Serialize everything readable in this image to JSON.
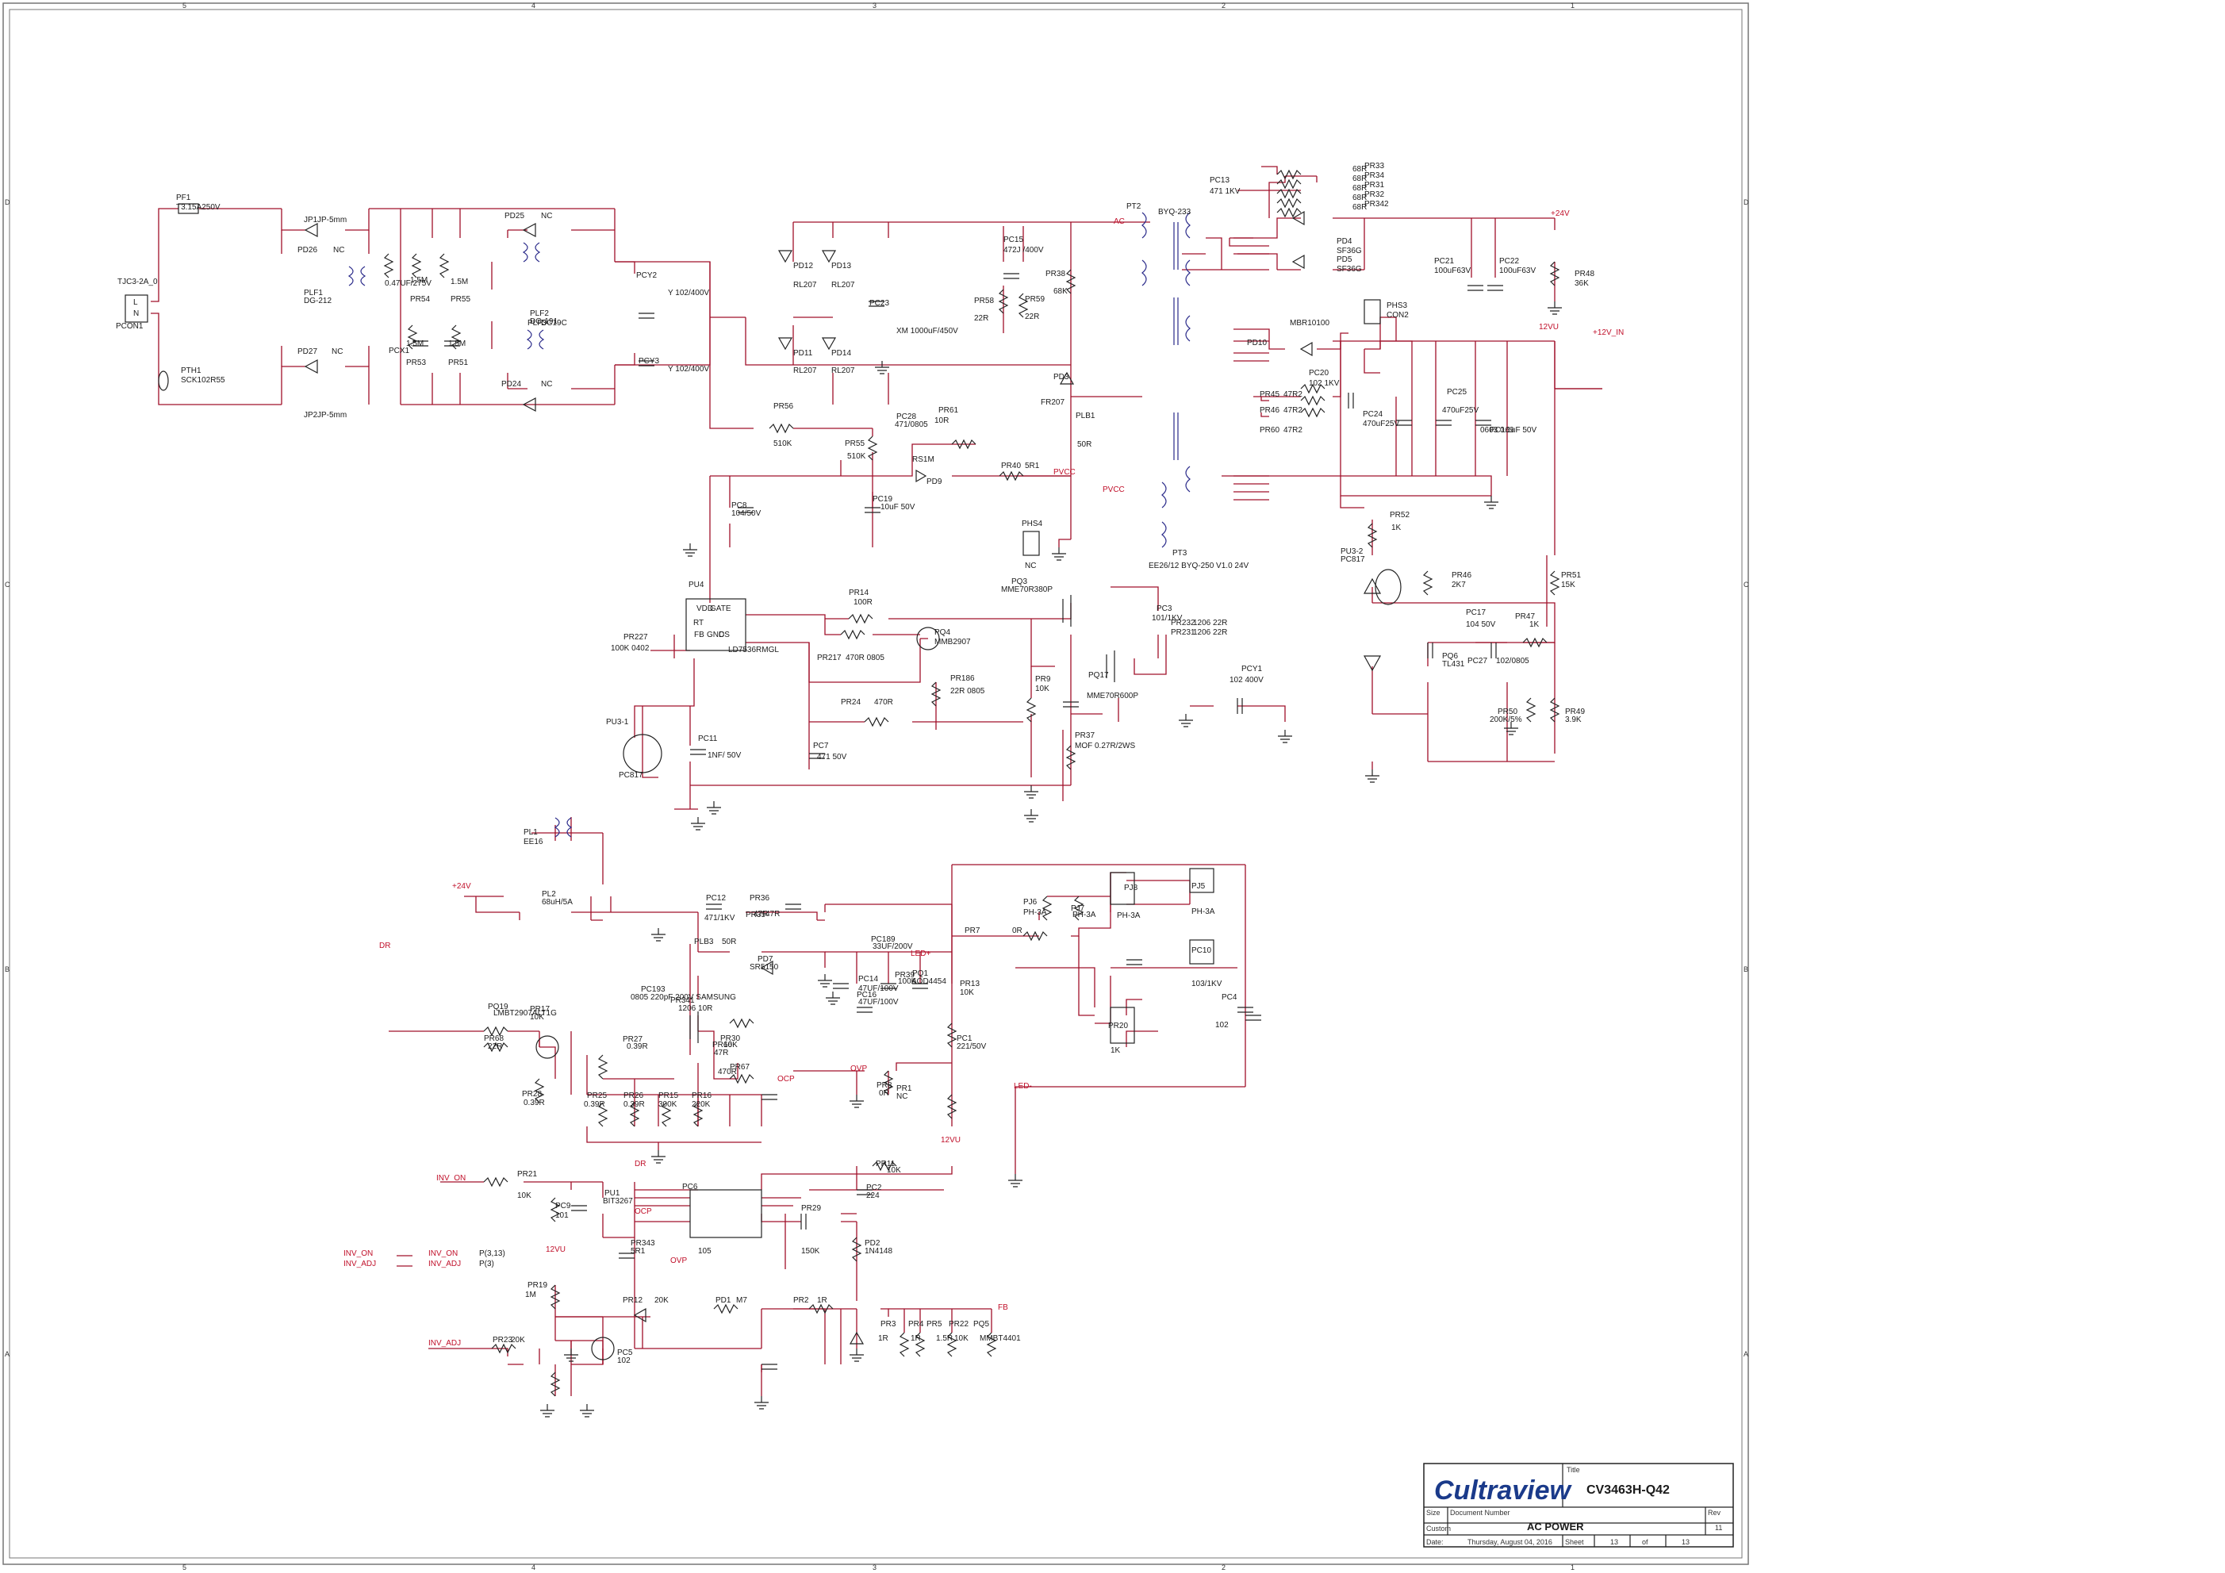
{
  "frame": {
    "top_numbers": [
      "5",
      "4",
      "3",
      "2",
      "1"
    ],
    "side_letters": [
      "D",
      "C",
      "B",
      "A"
    ]
  },
  "title_block": {
    "logo": "Cultraview",
    "title_label": "Title",
    "title": "CV3463H-Q42",
    "size_label": "Size",
    "size_value": "Custom",
    "doc_label": "Document Number",
    "doc_value": "AC POWER",
    "rev_label": "Rev",
    "rev_value": "11",
    "date_label": "Date:",
    "date_value": "Thursday, August 04, 2016",
    "sheet_label": "Sheet",
    "sheet_value": "13",
    "of_label": "of",
    "of_value": "13"
  },
  "nets": [
    {
      "text": "+24V"
    },
    {
      "text": "12VU"
    },
    {
      "text": "+12V_IN"
    },
    {
      "text": "+24V"
    },
    {
      "text": "DR"
    },
    {
      "text": "LED+"
    },
    {
      "text": "LED-"
    },
    {
      "text": "OVP"
    },
    {
      "text": "OCP"
    },
    {
      "text": "12VU"
    },
    {
      "text": "INV_ON"
    },
    {
      "text": "DR"
    },
    {
      "text": "OCP"
    },
    {
      "text": "OVP"
    },
    {
      "text": "12VU"
    },
    {
      "text": "FB"
    },
    {
      "text": "INV_ADJ"
    },
    {
      "text": "PVCC"
    },
    {
      "text": "PVCC"
    },
    {
      "text": "AC"
    }
  ],
  "offpage": [
    {
      "text": "INV_ON"
    },
    {
      "text": "INV_ADJ"
    },
    {
      "text": "INV_ON"
    },
    {
      "text": "INV_ADJ"
    },
    {
      "text": "P(3,13)"
    },
    {
      "text": "P(3)"
    }
  ],
  "labels": [
    {
      "text": "PF1"
    },
    {
      "text": "T3.15A250V"
    },
    {
      "text": "TJC3-2A_0"
    },
    {
      "text": "PCON1"
    },
    {
      "text": "L"
    },
    {
      "text": "N"
    },
    {
      "text": "PTH1"
    },
    {
      "text": "SCK102R55"
    },
    {
      "text": "JP1"
    },
    {
      "text": "JP-5mm"
    },
    {
      "text": "JP2"
    },
    {
      "text": "JP-5mm"
    },
    {
      "text": "PD26"
    },
    {
      "text": "NC"
    },
    {
      "text": "PD27"
    },
    {
      "text": "NC"
    },
    {
      "text": "PLF1"
    },
    {
      "text": "DG-212"
    },
    {
      "text": "PCX1"
    },
    {
      "text": "0.47UF/275V"
    },
    {
      "text": "PR54"
    },
    {
      "text": "1.5M"
    },
    {
      "text": "PR53"
    },
    {
      "text": "1.5M"
    },
    {
      "text": "PR55"
    },
    {
      "text": "1.5M"
    },
    {
      "text": "PR51"
    },
    {
      "text": "1.5M"
    },
    {
      "text": "PD25"
    },
    {
      "text": "NC"
    },
    {
      "text": "PD24"
    },
    {
      "text": "NC"
    },
    {
      "text": "PLF2"
    },
    {
      "text": "DG-191"
    },
    {
      "text": "PLF3"
    },
    {
      "text": "DC19C"
    },
    {
      "text": "PCY2"
    },
    {
      "text": "Y 102/400V"
    },
    {
      "text": "PCY3"
    },
    {
      "text": "Y 102/400V"
    },
    {
      "text": "PD12"
    },
    {
      "text": "RL207"
    },
    {
      "text": "PD13"
    },
    {
      "text": "RL207"
    },
    {
      "text": "PD11"
    },
    {
      "text": "RL207"
    },
    {
      "text": "PD14"
    },
    {
      "text": "RL207"
    },
    {
      "text": "PC23"
    },
    {
      "text": "XM 1000uF/450V"
    },
    {
      "text": "PR56"
    },
    {
      "text": "510K"
    },
    {
      "text": "PR55"
    },
    {
      "text": "510K"
    },
    {
      "text": "PC15"
    },
    {
      "text": "472J /400V"
    },
    {
      "text": "PR58"
    },
    {
      "text": "22R"
    },
    {
      "text": "PR59"
    },
    {
      "text": "22R"
    },
    {
      "text": "PR38"
    },
    {
      "text": "68K"
    },
    {
      "text": "PD3"
    },
    {
      "text": "FR207"
    },
    {
      "text": "PT2"
    },
    {
      "text": "BYQ-233"
    },
    {
      "text": "PLB1"
    },
    {
      "text": "50R"
    },
    {
      "text": "PC28"
    },
    {
      "text": "471/0805"
    },
    {
      "text": "PR61"
    },
    {
      "text": "10R"
    },
    {
      "text": "RS1M"
    },
    {
      "text": "PD9"
    },
    {
      "text": "PR40"
    },
    {
      "text": "5R1"
    },
    {
      "text": "PC8"
    },
    {
      "text": "104/50V"
    },
    {
      "text": "PC19"
    },
    {
      "text": "10uF 50V"
    },
    {
      "text": "PHS4"
    },
    {
      "text": "NC"
    },
    {
      "text": "PT3"
    },
    {
      "text": "EE26/12  BYQ-250 V1.0  24V"
    },
    {
      "text": "PC13"
    },
    {
      "text": "471 1KV"
    },
    {
      "text": "PR33"
    },
    {
      "text": "68R"
    },
    {
      "text": "PR34"
    },
    {
      "text": "68R"
    },
    {
      "text": "PR31"
    },
    {
      "text": "68R"
    },
    {
      "text": "PR32"
    },
    {
      "text": "68R"
    },
    {
      "text": "PR342"
    },
    {
      "text": "68R"
    },
    {
      "text": "PD4"
    },
    {
      "text": "SF36G"
    },
    {
      "text": "PD5"
    },
    {
      "text": "SF36G"
    },
    {
      "text": "PC21"
    },
    {
      "text": "100uF63V"
    },
    {
      "text": "PC22"
    },
    {
      "text": "100uF63V"
    },
    {
      "text": "PR48"
    },
    {
      "text": "36K"
    },
    {
      "text": "PHS3"
    },
    {
      "text": "CON2"
    },
    {
      "text": "PD10"
    },
    {
      "text": "MBR10100"
    },
    {
      "text": "PR45"
    },
    {
      "text": "47R2"
    },
    {
      "text": "PR46"
    },
    {
      "text": "47R2"
    },
    {
      "text": "PR60"
    },
    {
      "text": "47R2"
    },
    {
      "text": "PC20"
    },
    {
      "text": "102  1KV"
    },
    {
      "text": "PC24"
    },
    {
      "text": "470uF25V"
    },
    {
      "text": "PC25"
    },
    {
      "text": "470uF25V"
    },
    {
      "text": "PC169"
    },
    {
      "text": "0603 0.1uF 50V"
    },
    {
      "text": "PR52"
    },
    {
      "text": "1K"
    },
    {
      "text": "PU3-2"
    },
    {
      "text": "PC817"
    },
    {
      "text": "PR46"
    },
    {
      "text": "2K7"
    },
    {
      "text": "PR51"
    },
    {
      "text": "15K"
    },
    {
      "text": "PC17"
    },
    {
      "text": "104  50V"
    },
    {
      "text": "PR47"
    },
    {
      "text": "1K"
    },
    {
      "text": "PQ6"
    },
    {
      "text": "TL431"
    },
    {
      "text": "PC27"
    },
    {
      "text": "102/0805"
    },
    {
      "text": "PR50"
    },
    {
      "text": "200K/5%"
    },
    {
      "text": "PR49"
    },
    {
      "text": "3.9K"
    },
    {
      "text": "PU4"
    },
    {
      "text": "LD7536RMGL"
    },
    {
      "text": "VDD"
    },
    {
      "text": "GATE"
    },
    {
      "text": "RT"
    },
    {
      "text": "FB"
    },
    {
      "text": "GND"
    },
    {
      "text": "CS"
    },
    {
      "text": "PR227"
    },
    {
      "text": "100K 0402"
    },
    {
      "text": "PR14"
    },
    {
      "text": "100R"
    },
    {
      "text": "PR217"
    },
    {
      "text": "470R 0805"
    },
    {
      "text": "PQ4"
    },
    {
      "text": "MMB2907"
    },
    {
      "text": "PR186"
    },
    {
      "text": "22R 0805"
    },
    {
      "text": "PQ3"
    },
    {
      "text": "MME70R380P"
    },
    {
      "text": "PQ17"
    },
    {
      "text": "MME70R600P"
    },
    {
      "text": "PC3"
    },
    {
      "text": "101/1KV"
    },
    {
      "text": "PR232"
    },
    {
      "text": "1206 22R"
    },
    {
      "text": "PR231"
    },
    {
      "text": "1206 22R"
    },
    {
      "text": "PR9"
    },
    {
      "text": "10K"
    },
    {
      "text": "PR24"
    },
    {
      "text": "470R"
    },
    {
      "text": "PCY1"
    },
    {
      "text": "102 400V"
    },
    {
      "text": "PR37"
    },
    {
      "text": "MOF 0.27R/2WS"
    },
    {
      "text": "PU3-1"
    },
    {
      "text": "PC817"
    },
    {
      "text": "PC11"
    },
    {
      "text": "1NF/ 50V"
    },
    {
      "text": "PC7"
    },
    {
      "text": "471 50V"
    },
    {
      "text": "PL1"
    },
    {
      "text": "EE16"
    },
    {
      "text": "PL2"
    },
    {
      "text": "68uH/5A"
    },
    {
      "text": "PC12"
    },
    {
      "text": "471/1KV"
    },
    {
      "text": "PR36"
    },
    {
      "text": "47R"
    },
    {
      "text": "PR35"
    },
    {
      "text": "47R"
    },
    {
      "text": "PLB3"
    },
    {
      "text": "50R"
    },
    {
      "text": "PD7"
    },
    {
      "text": "SR5150"
    },
    {
      "text": "PC189"
    },
    {
      "text": "33UF/200V"
    },
    {
      "text": "PR39"
    },
    {
      "text": "100K"
    },
    {
      "text": "PC14"
    },
    {
      "text": "47UF/100V"
    },
    {
      "text": "PC16"
    },
    {
      "text": "47UF/100V"
    },
    {
      "text": "PQ1"
    },
    {
      "text": "AOD4454"
    },
    {
      "text": "PC193"
    },
    {
      "text": "0805 220pF 200V SAMSUNG"
    },
    {
      "text": "PR341"
    },
    {
      "text": "1206 10R"
    },
    {
      "text": "PR30"
    },
    {
      "text": "10K"
    },
    {
      "text": "PR66"
    },
    {
      "text": "47R"
    },
    {
      "text": "PR67"
    },
    {
      "text": "470R"
    },
    {
      "text": "PQ19"
    },
    {
      "text": "LMBT2907ALT1G"
    },
    {
      "text": "PR68"
    },
    {
      "text": "22R"
    },
    {
      "text": "PR17"
    },
    {
      "text": "10K"
    },
    {
      "text": "PR28"
    },
    {
      "text": "0.39R"
    },
    {
      "text": "PR27"
    },
    {
      "text": "0.39R"
    },
    {
      "text": "PR25"
    },
    {
      "text": "0.39R"
    },
    {
      "text": "PR26"
    },
    {
      "text": "0.39R"
    },
    {
      "text": "PR15"
    },
    {
      "text": "300K"
    },
    {
      "text": "PR16"
    },
    {
      "text": "220K"
    },
    {
      "text": "PR13"
    },
    {
      "text": "10K"
    },
    {
      "text": "PC1"
    },
    {
      "text": "221/50V"
    },
    {
      "text": "PR8"
    },
    {
      "text": "0R"
    },
    {
      "text": "PR1"
    },
    {
      "text": "NC"
    },
    {
      "text": "PR7"
    },
    {
      "text": "0R"
    },
    {
      "text": "PJ6"
    },
    {
      "text": "PH-3A"
    },
    {
      "text": "PJ7"
    },
    {
      "text": "PH-3A"
    },
    {
      "text": "PJ8"
    },
    {
      "text": "PH-3A"
    },
    {
      "text": "PJ5"
    },
    {
      "text": "PH-3A"
    },
    {
      "text": "PC10"
    },
    {
      "text": "103/1KV"
    },
    {
      "text": "PR20"
    },
    {
      "text": "1K"
    },
    {
      "text": "PC4"
    },
    {
      "text": "102"
    },
    {
      "text": "PR21"
    },
    {
      "text": "10K"
    },
    {
      "text": "PU1"
    },
    {
      "text": "BIT3267"
    },
    {
      "text": "PC9"
    },
    {
      "text": "101"
    },
    {
      "text": "PC6"
    },
    {
      "text": "105"
    },
    {
      "text": "PR343"
    },
    {
      "text": "5R1"
    },
    {
      "text": "PC2"
    },
    {
      "text": "224"
    },
    {
      "text": "PR11"
    },
    {
      "text": "10K"
    },
    {
      "text": "PR29"
    },
    {
      "text": "150K"
    },
    {
      "text": "PD2"
    },
    {
      "text": "1N4148"
    },
    {
      "text": "PR19"
    },
    {
      "text": "1M"
    },
    {
      "text": "PR12"
    },
    {
      "text": "20K"
    },
    {
      "text": "PD1"
    },
    {
      "text": "M7"
    },
    {
      "text": "PR2"
    },
    {
      "text": "1R"
    },
    {
      "text": "PR3"
    },
    {
      "text": "1R"
    },
    {
      "text": "PR4"
    },
    {
      "text": "1R"
    },
    {
      "text": "PR5"
    },
    {
      "text": "1.5R"
    },
    {
      "text": "PR22"
    },
    {
      "text": "10K"
    },
    {
      "text": "PQ5"
    },
    {
      "text": "MMBT4401"
    },
    {
      "text": "PR23"
    },
    {
      "text": "20K"
    },
    {
      "text": "PC5"
    },
    {
      "text": "102"
    }
  ]
}
